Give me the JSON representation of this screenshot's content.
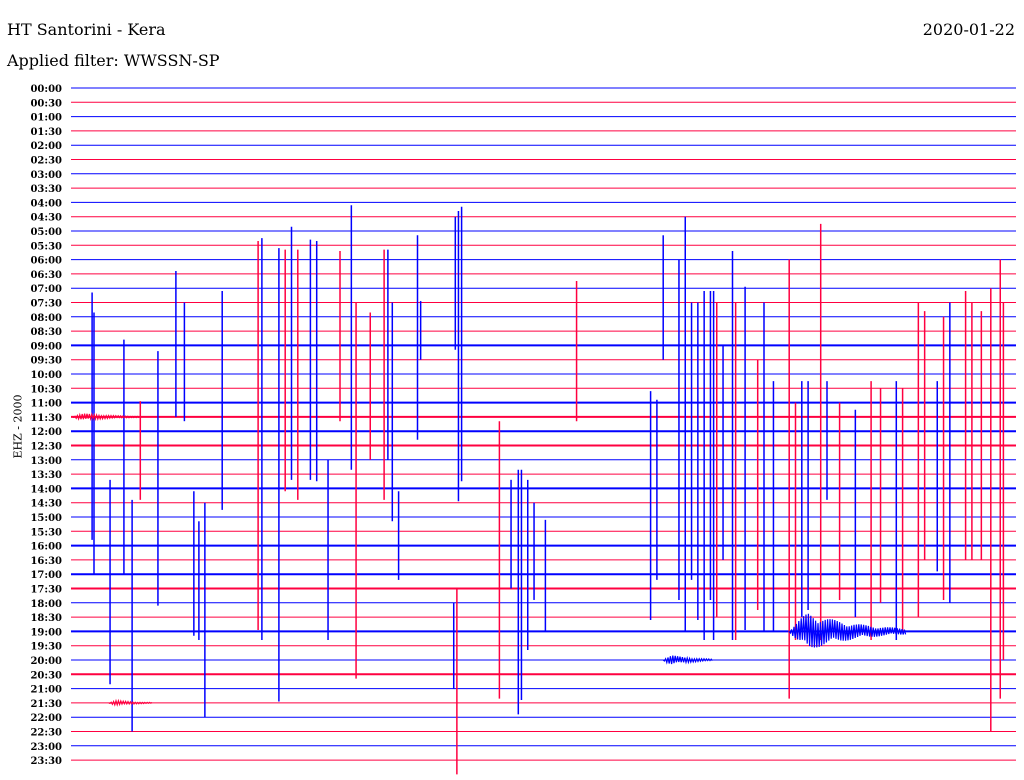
{
  "header": {
    "title": "HT Santorini - Kera",
    "date": "2020-01-22",
    "filter": "Applied filter: WWSSN-SP",
    "channel": "EHZ - 2000"
  },
  "chart_data": {
    "type": "line",
    "title": "HT Santorini - Kera",
    "ylabel": "EHZ - 2000",
    "minutes_per_line": 30,
    "tick_labels": [
      "00:00",
      "00:30",
      "01:00",
      "01:30",
      "02:00",
      "02:30",
      "03:00",
      "03:30",
      "04:00",
      "04:30",
      "05:00",
      "05:30",
      "06:00",
      "06:30",
      "07:00",
      "07:30",
      "08:00",
      "08:30",
      "09:00",
      "09:30",
      "10:00",
      "10:30",
      "11:00",
      "11:30",
      "12:00",
      "12:30",
      "13:00",
      "13:30",
      "14:00",
      "14:30",
      "15:00",
      "15:30",
      "16:00",
      "16:30",
      "17:00",
      "17:30",
      "18:00",
      "18:30",
      "19:00",
      "19:30",
      "20:00",
      "20:30",
      "21:00",
      "21:30",
      "22:00",
      "22:30",
      "23:00",
      "23:30"
    ],
    "colors": {
      "even": "#0000ff",
      "odd": "#ff0040",
      "dark": "#000000"
    },
    "noisy_traces": [
      18,
      22,
      23,
      24,
      25,
      28,
      32,
      34,
      35,
      38,
      41
    ],
    "spikes": [
      [
        24,
        0.67,
        9.7,
        7.6
      ],
      [
        24,
        0.73,
        8.3,
        10
      ],
      [
        34,
        1.24,
        6.6,
        7.7
      ],
      [
        24,
        1.68,
        6.4,
        10
      ],
      [
        38,
        1.94,
        9.2,
        7
      ],
      [
        23,
        2.2,
        1.1,
        5.8
      ],
      [
        28,
        2.76,
        9.6,
        8.2
      ],
      [
        22,
        3.33,
        9.2,
        1
      ],
      [
        22,
        3.6,
        7,
        1.3
      ],
      [
        38,
        3.9,
        9.8,
        0.3
      ],
      [
        38,
        4.06,
        7.7,
        0.6
      ],
      [
        40,
        4.25,
        11,
        4
      ],
      [
        24,
        4.8,
        9.8,
        5.5
      ],
      [
        25,
        5.94,
        14.3,
        12.9
      ],
      [
        24,
        6.06,
        13.5,
        14.6
      ],
      [
        34,
        6.6,
        22.8,
        8.9
      ],
      [
        25,
        6.8,
        13.7,
        3.2
      ],
      [
        22,
        7.0,
        12.3,
        5.4
      ],
      [
        25,
        7.2,
        13.7,
        3.8
      ],
      [
        24,
        7.6,
        13.4,
        3.4
      ],
      [
        22,
        7.8,
        11.3,
        5.5
      ],
      [
        38,
        8.16,
        12,
        0.6
      ],
      [
        23,
        8.54,
        11.6,
        0.3
      ],
      [
        18,
        8.9,
        9.8,
        8.7
      ],
      [
        35,
        9.05,
        20,
        6.3
      ],
      [
        23,
        9.5,
        7.3,
        3
      ],
      [
        25,
        9.94,
        13.7,
        3.8
      ],
      [
        24,
        10.06,
        12.7,
        2
      ],
      [
        22,
        10.2,
        7,
        8.3
      ],
      [
        34,
        10.4,
        5.8,
        0.4
      ],
      [
        18,
        11.0,
        7.7,
        6.6
      ],
      [
        18,
        11.1,
        3.1,
        1
      ],
      [
        18,
        12.2,
        9,
        0.3
      ],
      [
        22,
        12.3,
        13.4,
        6.9
      ],
      [
        22,
        12.4,
        13.7,
        5.5
      ],
      [
        41,
        12.25,
        6,
        7
      ],
      [
        40,
        12.15,
        4,
        2
      ],
      [
        35,
        13.6,
        11.7,
        7.7
      ],
      [
        34,
        13.97,
        6.6,
        1
      ],
      [
        38,
        14.2,
        11.3,
        5.8
      ],
      [
        38,
        14.3,
        11.3,
        4.8
      ],
      [
        38,
        14.5,
        10.6,
        1.3
      ],
      [
        34,
        14.7,
        5,
        1.8
      ],
      [
        34,
        15.06,
        3.8,
        4
      ],
      [
        23,
        16.05,
        9.5,
        0.3
      ],
      [
        28,
        18.4,
        6.8,
        9.2
      ],
      [
        28,
        18.6,
        6.2,
        6.4
      ],
      [
        18,
        18.8,
        7.7,
        1
      ],
      [
        28,
        19.3,
        16,
        7.8
      ],
      [
        24,
        19.5,
        15,
        14
      ],
      [
        28,
        19.7,
        13,
        6.4
      ],
      [
        28,
        19.9,
        13,
        9.2
      ],
      [
        28,
        20.1,
        13.8,
        10.6
      ],
      [
        28,
        20.3,
        13.8,
        7.8
      ],
      [
        28,
        20.4,
        13.8,
        10.6
      ],
      [
        25,
        20.5,
        10,
        12
      ],
      [
        28,
        20.7,
        10,
        5
      ],
      [
        28,
        21.0,
        16.6,
        10.6
      ],
      [
        35,
        21.1,
        20,
        3.6
      ],
      [
        28,
        21.4,
        14.1,
        9.9
      ],
      [
        35,
        21.8,
        16,
        1.5
      ],
      [
        28,
        22.0,
        13,
        10
      ],
      [
        28,
        22.3,
        7.5,
        10
      ],
      [
        35,
        22.8,
        23,
        7.7
      ],
      [
        35,
        23.0,
        13,
        3.6
      ],
      [
        28,
        23.2,
        7.5,
        9
      ],
      [
        28,
        23.4,
        7.5,
        8.5
      ],
      [
        35,
        23.8,
        25.5,
        3.6
      ],
      [
        28,
        24.0,
        7.5,
        0.8
      ],
      [
        35,
        24.4,
        13,
        0.8
      ],
      [
        28,
        24.9,
        5.5,
        9
      ],
      [
        35,
        25.4,
        14.5,
        3.6
      ],
      [
        35,
        25.7,
        14,
        1
      ],
      [
        28,
        26.2,
        7.5,
        10.6
      ],
      [
        35,
        26.4,
        14,
        3
      ],
      [
        35,
        26.9,
        20,
        2
      ],
      [
        25,
        27.1,
        9.4,
        8
      ],
      [
        28,
        27.5,
        7.5,
        5.8
      ],
      [
        35,
        27.7,
        19,
        0.8
      ],
      [
        28,
        27.9,
        13,
        8
      ],
      [
        25,
        28.4,
        10.8,
        8
      ],
      [
        25,
        28.6,
        10,
        8
      ],
      [
        25,
        28.9,
        9.4,
        8
      ],
      [
        35,
        29.2,
        21,
        10
      ],
      [
        35,
        29.5,
        23,
        7.7
      ],
      [
        25,
        29.6,
        10,
        15
      ]
    ],
    "bursts": [
      [
        38,
        22.8,
        26.5,
        1.9
      ],
      [
        40,
        18.8,
        20.4,
        0.5
      ],
      [
        43,
        1.2,
        2.6,
        0.25
      ],
      [
        23,
        0.05,
        2.2,
        0.35
      ]
    ]
  }
}
